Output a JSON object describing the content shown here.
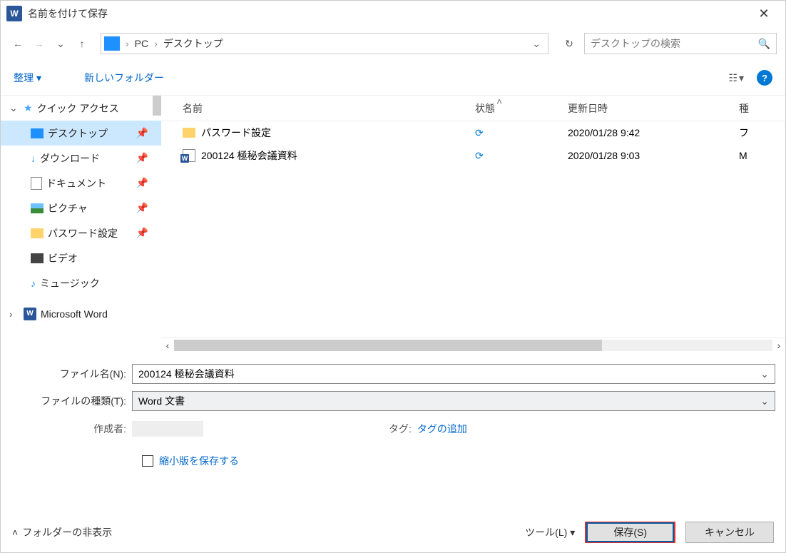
{
  "title": "名前を付けて保存",
  "breadcrumb": {
    "pc": "PC",
    "folder": "デスクトップ"
  },
  "search": {
    "placeholder": "デスクトップの検索"
  },
  "toolbar": {
    "organize": "整理",
    "newfolder": "新しいフォルダー"
  },
  "columns": {
    "name": "名前",
    "state": "状態",
    "date": "更新日時",
    "type": "種"
  },
  "files": [
    {
      "name": "パスワード設定",
      "date": "2020/01/28 9:42",
      "type": "フ",
      "kind": "folder"
    },
    {
      "name": "200124 極秘会議資料",
      "date": "2020/01/28 9:03",
      "type": "M",
      "kind": "word"
    }
  ],
  "sidebar": {
    "quick": "クイック アクセス",
    "items": [
      "デスクトップ",
      "ダウンロード",
      "ドキュメント",
      "ピクチャ",
      "パスワード設定",
      "ビデオ",
      "ミュージック"
    ],
    "word": "Microsoft Word"
  },
  "form": {
    "filename_label": "ファイル名(N):",
    "filename_value": "200124 極秘会議資料",
    "filetype_label": "ファイルの種類(T):",
    "filetype_value": "Word 文書",
    "author_label": "作成者:",
    "tag_label": "タグ:",
    "tag_link": "タグの追加",
    "thumbnail": "縮小版を保存する"
  },
  "footer": {
    "hide": "フォルダーの非表示",
    "tools": "ツール(L)",
    "save": "保存(S)",
    "cancel": "キャンセル"
  }
}
